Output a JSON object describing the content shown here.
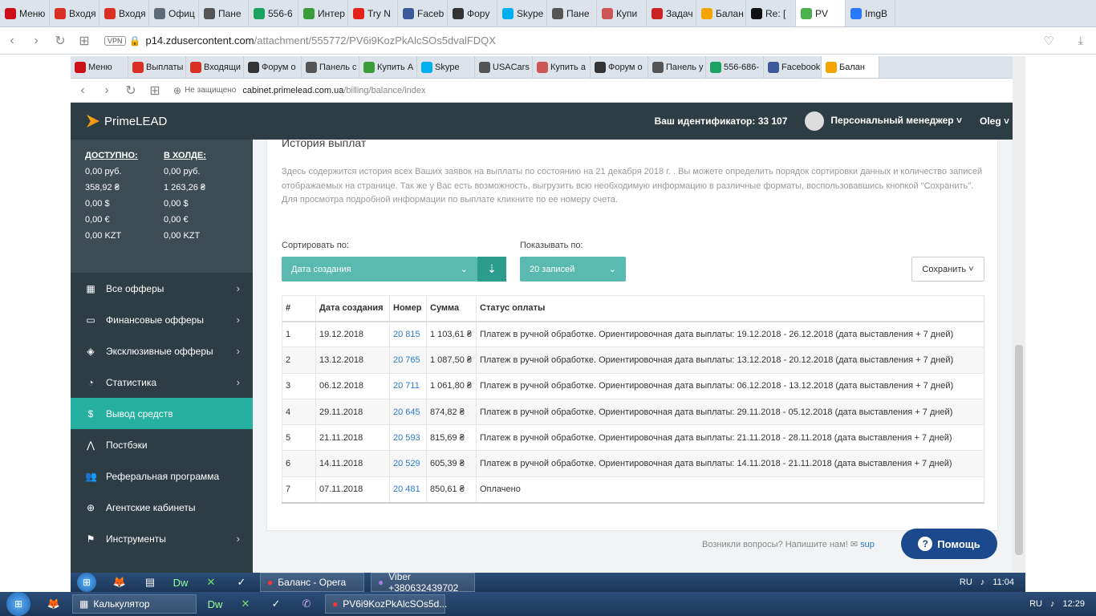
{
  "outer_browser": {
    "tabs": [
      {
        "label": "Меню",
        "icon": "opera-icon",
        "color": "#cc0f16"
      },
      {
        "label": "Входя",
        "icon": "gmail-icon",
        "color": "#d93025"
      },
      {
        "label": "Входя",
        "icon": "gmail-icon",
        "color": "#d93025"
      },
      {
        "label": "Офиц",
        "icon": "globe-icon",
        "color": "#5b6b7a"
      },
      {
        "label": "Пане",
        "icon": "page-icon",
        "color": "#555"
      },
      {
        "label": "556-6",
        "icon": "drive-icon",
        "color": "#1aa260"
      },
      {
        "label": "Интер",
        "icon": "leaf-icon",
        "color": "#3a9d3a"
      },
      {
        "label": "Try N",
        "icon": "youtube-icon",
        "color": "#e62117"
      },
      {
        "label": "Faceb",
        "icon": "facebook-icon",
        "color": "#3b5998"
      },
      {
        "label": "Фору",
        "icon": "forum-icon",
        "color": "#333"
      },
      {
        "label": "Skype",
        "icon": "skype-icon",
        "color": "#00aff0"
      },
      {
        "label": "Пане",
        "icon": "page-icon",
        "color": "#555"
      },
      {
        "label": "Купи",
        "icon": "shop-icon",
        "color": "#c55"
      },
      {
        "label": "Задач",
        "icon": "task-icon",
        "color": "#c22"
      },
      {
        "label": "Балан",
        "icon": "primelead-icon",
        "color": "#f4a300"
      },
      {
        "label": "Re: [",
        "icon": "plus-icon",
        "color": "#111"
      },
      {
        "label": "PV",
        "icon": "pv-icon",
        "color": "#4caf50"
      },
      {
        "label": "ImgB",
        "icon": "imgbb-icon",
        "color": "#2979ff"
      }
    ],
    "url_host": "p14.zdusercontent.com",
    "url_path": "/attachment/555772/PV6i9KozPkAlcSOs5dvalFDQX",
    "vpn_label": "VPN"
  },
  "inner_browser": {
    "tabs": [
      {
        "label": "Меню",
        "icon": "opera-icon",
        "color": "#cc0f16"
      },
      {
        "label": "Выплаты",
        "icon": "gmail-icon",
        "color": "#d93025"
      },
      {
        "label": "Входящи",
        "icon": "gmail-icon",
        "color": "#d93025"
      },
      {
        "label": "Форум о",
        "icon": "forum-icon",
        "color": "#333"
      },
      {
        "label": "Панель с",
        "icon": "page-icon",
        "color": "#555"
      },
      {
        "label": "Купить А",
        "icon": "leaf-icon",
        "color": "#3a9d3a"
      },
      {
        "label": "Skype",
        "icon": "skype-icon",
        "color": "#00aff0"
      },
      {
        "label": "USACars",
        "icon": "page-icon",
        "color": "#555"
      },
      {
        "label": "Купить а",
        "icon": "shop-icon",
        "color": "#c55"
      },
      {
        "label": "Форум о",
        "icon": "forum-icon",
        "color": "#333"
      },
      {
        "label": "Панель у",
        "icon": "page-icon",
        "color": "#555"
      },
      {
        "label": "556-686-",
        "icon": "drive-icon",
        "color": "#1aa260"
      },
      {
        "label": "Facebook",
        "icon": "facebook-icon",
        "color": "#3b5998"
      },
      {
        "label": "Балан",
        "icon": "primelead-icon",
        "color": "#f4a300"
      }
    ],
    "insecure_label": "Не защищено",
    "url_host": "cabinet.primelead.com.ua",
    "url_path": "/billing/balance/index"
  },
  "header": {
    "logo_text": "PrimeLEAD",
    "user_id_label": "Ваш идентификатор: 33 107",
    "manager_label": "Персональный менеджер",
    "user_name": "Oleg"
  },
  "balances": {
    "available_label": "ДОСТУПНО:",
    "hold_label": "В ХОЛДЕ:",
    "rows": [
      {
        "available": "0,00 руб.",
        "hold": "0,00 руб."
      },
      {
        "available": "358,92 ₴",
        "hold": "1 263,26 ₴"
      },
      {
        "available": "0,00 $",
        "hold": "0,00 $"
      },
      {
        "available": "0,00 €",
        "hold": "0,00 €"
      },
      {
        "available": "0,00 KZT",
        "hold": "0,00 KZT"
      }
    ]
  },
  "sidebar": {
    "items": [
      {
        "label": "Все офферы",
        "icon": "grid-icon",
        "has_chevron": true
      },
      {
        "label": "Финансовые офферы",
        "icon": "monitor-icon",
        "has_chevron": true
      },
      {
        "label": "Эксклюзивные офферы",
        "icon": "tag-icon",
        "has_chevron": true
      },
      {
        "label": "Статистика",
        "icon": "pie-chart-icon",
        "has_chevron": true
      },
      {
        "label": "Вывод средств",
        "icon": "dollar-icon",
        "has_chevron": false,
        "active": true
      },
      {
        "label": "Постбэки",
        "icon": "hook-icon",
        "has_chevron": false
      },
      {
        "label": "Реферальная программа",
        "icon": "users-icon",
        "has_chevron": false
      },
      {
        "label": "Агентские кабинеты",
        "icon": "globe-icon",
        "has_chevron": false
      },
      {
        "label": "Инструменты",
        "icon": "flag-icon",
        "has_chevron": true
      }
    ]
  },
  "main": {
    "title": "История выплат",
    "description": "Здесь содержится история всех Ваших заявок на выплаты по состоянию на 21 декабря 2018 г. . Вы можете определить порядок сортировки данных и количество записей отображаемых на странице. Так же у Вас есть возможность, выгрузить всю необходимую информацию в различные форматы, воспользовавшись кнопкой \"Сохранить\". Для просмотра подробной информации по выплате кликните по ее номеру счета.",
    "sort_label": "Сортировать по:",
    "sort_value": "Дата создания",
    "show_label": "Показывать по:",
    "show_value": "20 записей",
    "save_label": "Сохранить",
    "table": {
      "headers": [
        "#",
        "Дата создания",
        "Номер",
        "Сумма",
        "Статус оплаты"
      ],
      "rows": [
        [
          "1",
          "19.12.2018",
          "20 815",
          "1 103,61 ₴",
          "Платеж в ручной обработке. Ориентировочная дата выплаты: 19.12.2018 - 26.12.2018 (дата выставления + 7 дней)"
        ],
        [
          "2",
          "13.12.2018",
          "20 765",
          "1 087,50 ₴",
          "Платеж в ручной обработке. Ориентировочная дата выплаты: 13.12.2018 - 20.12.2018 (дата выставления + 7 дней)"
        ],
        [
          "3",
          "06.12.2018",
          "20 711",
          "1 061,80 ₴",
          "Платеж в ручной обработке. Ориентировочная дата выплаты: 06.12.2018 - 13.12.2018 (дата выставления + 7 дней)"
        ],
        [
          "4",
          "29.11.2018",
          "20 645",
          "874,82 ₴",
          "Платеж в ручной обработке. Ориентировочная дата выплаты: 29.11.2018 - 05.12.2018 (дата выставления + 7 дней)"
        ],
        [
          "5",
          "21.11.2018",
          "20 593",
          "815,69 ₴",
          "Платеж в ручной обработке. Ориентировочная дата выплаты: 21.11.2018 - 28.11.2018 (дата выставления + 7 дней)"
        ],
        [
          "6",
          "14.11.2018",
          "20 529",
          "605,39 ₴",
          "Платеж в ручной обработке. Ориентировочная дата выплаты: 14.11.2018 - 21.11.2018 (дата выставления + 7 дней)"
        ],
        [
          "7",
          "07.11.2018",
          "20 481",
          "850,61 ₴",
          "Оплачено"
        ]
      ]
    },
    "footer_question": "Возникли вопросы? Напишите нам!",
    "footer_link": "sup",
    "help_label": "Помощь"
  },
  "taskbar_inner": {
    "tasks": [
      "Баланс - Opera",
      "Viber +380632439702"
    ],
    "lang": "RU",
    "time": "11:04"
  },
  "taskbar_outer": {
    "tasks": [
      "Калькулятор",
      "PV6i9KozPkAlcSOs5d..."
    ],
    "lang": "RU",
    "time": "12:29"
  },
  "colors": {
    "sidebar_bg": "#2c3e44",
    "accent": "#26b0a0",
    "link": "#2a7bd0",
    "help_bg": "#1a4a8d"
  }
}
